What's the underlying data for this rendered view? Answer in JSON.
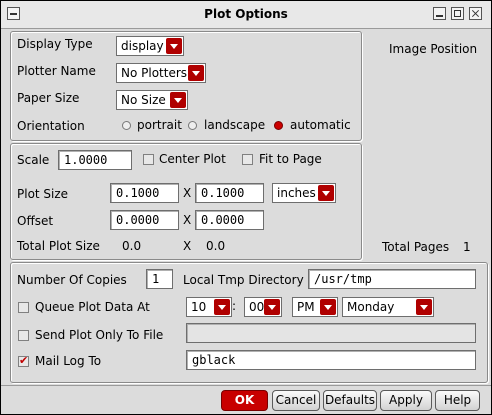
{
  "window": {
    "title": "Plot Options"
  },
  "display": {
    "type_label": "Display Type",
    "type_value": "display",
    "plotter_label": "Plotter Name",
    "plotter_value": "No Plotters",
    "paper_label": "Paper Size",
    "paper_value": "No Size",
    "orientation_label": "Orientation",
    "orientation_options": [
      "portrait",
      "landscape",
      "automatic"
    ],
    "orientation_selected": "automatic",
    "image_position_label": "Image Position"
  },
  "scale": {
    "scale_label": "Scale",
    "scale_value": "1.0000",
    "center_plot_label": "Center Plot",
    "center_plot_checked": false,
    "fit_to_page_label": "Fit to Page",
    "fit_to_page_checked": false,
    "plot_size_label": "Plot Size",
    "plot_size_x": "0.1000",
    "plot_size_y": "0.1000",
    "x_sep": "X",
    "units_value": "inches",
    "offset_label": "Offset",
    "offset_x": "0.0000",
    "offset_y": "0.0000",
    "total_plot_size_label": "Total Plot Size",
    "total_x": "0.0",
    "total_y": "0.0",
    "total_pages_label": "Total Pages",
    "total_pages_value": "1"
  },
  "job": {
    "copies_label": "Number Of Copies",
    "copies_value": "1",
    "tmp_dir_label": "Local Tmp Directory",
    "tmp_dir_value": "/usr/tmp",
    "queue_label": "Queue Plot Data At",
    "queue_checked": false,
    "hour": "10",
    "time_sep": ":",
    "minute": "00",
    "ampm": "PM",
    "day": "Monday",
    "send_file_label": "Send Plot Only To File",
    "send_file_checked": false,
    "send_file_value": "",
    "mail_label": "Mail Log To",
    "mail_checked": true,
    "mail_value": "gblack"
  },
  "buttons": {
    "ok": "OK",
    "cancel": "Cancel",
    "defaults": "Defaults",
    "apply": "Apply",
    "help": "Help"
  },
  "colors": {
    "accent": "#c80000",
    "background": "#dcdcdc"
  }
}
